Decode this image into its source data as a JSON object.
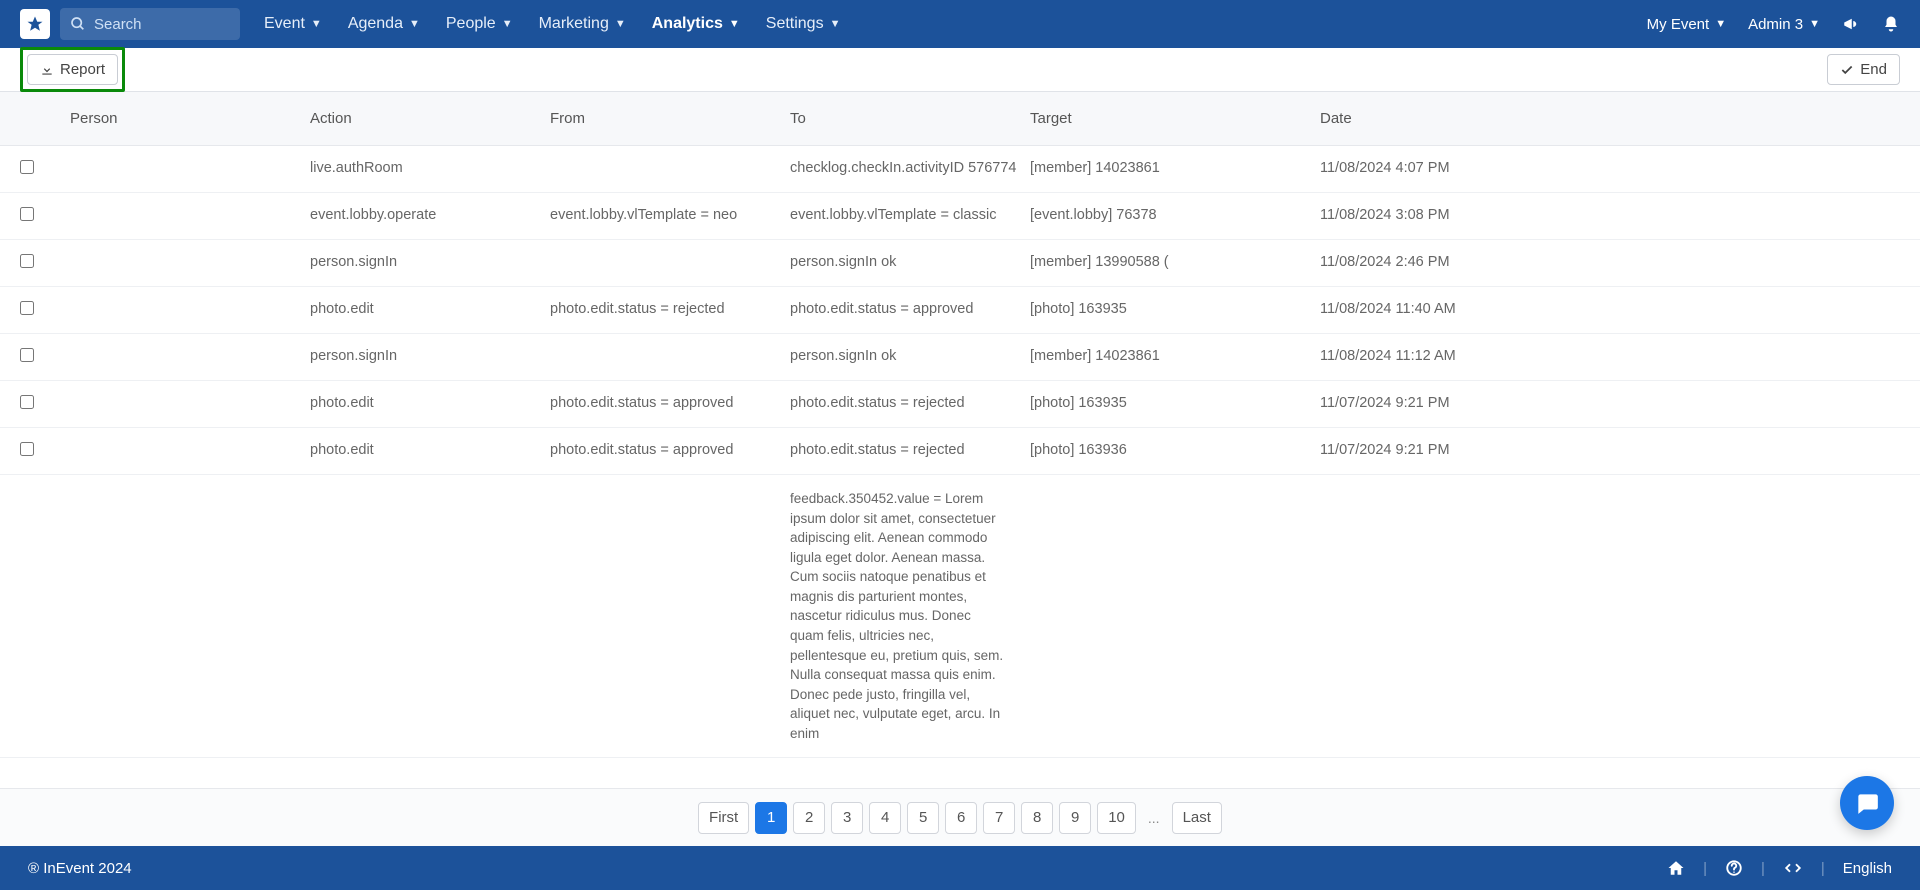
{
  "nav": {
    "search_placeholder": "Search",
    "items": [
      {
        "label": "Event",
        "active": false
      },
      {
        "label": "Agenda",
        "active": false
      },
      {
        "label": "People",
        "active": false
      },
      {
        "label": "Marketing",
        "active": false
      },
      {
        "label": "Analytics",
        "active": true
      },
      {
        "label": "Settings",
        "active": false
      }
    ],
    "context_label": "My Event",
    "user_label": "Admin 3"
  },
  "toolbar": {
    "report_label": "Report",
    "end_label": "End"
  },
  "table": {
    "headers": {
      "person": "Person",
      "action": "Action",
      "from": "From",
      "to": "To",
      "target": "Target",
      "date": "Date"
    },
    "rows": [
      {
        "person": "",
        "action": "live.authRoom",
        "from": "",
        "to": "checklog.checkIn.activityID 576774",
        "target": "[member] 14023861",
        "date": "11/08/2024 4:07 PM"
      },
      {
        "person": "",
        "action": "event.lobby.operate",
        "from": "event.lobby.vlTemplate = neo",
        "to": "event.lobby.vlTemplate = classic",
        "target": "[event.lobby] 76378",
        "date": "11/08/2024 3:08 PM"
      },
      {
        "person": "",
        "action": "person.signIn",
        "from": "",
        "to": "person.signIn ok",
        "target": "[member] 13990588 (",
        "date": "11/08/2024 2:46 PM"
      },
      {
        "person": "",
        "action": "photo.edit",
        "from": "photo.edit.status = rejected",
        "to": "photo.edit.status = approved",
        "target": "[photo] 163935",
        "date": "11/08/2024 11:40 AM"
      },
      {
        "person": "",
        "action": "person.signIn",
        "from": "",
        "to": "person.signIn ok",
        "target": "[member] 14023861",
        "date": "11/08/2024 11:12 AM"
      },
      {
        "person": "",
        "action": "photo.edit",
        "from": "photo.edit.status = approved",
        "to": "photo.edit.status = rejected",
        "target": "[photo] 163935",
        "date": "11/07/2024 9:21 PM"
      },
      {
        "person": "",
        "action": "photo.edit",
        "from": "photo.edit.status = approved",
        "to": "photo.edit.status = rejected",
        "target": "[photo] 163936",
        "date": "11/07/2024 9:21 PM"
      },
      {
        "person": "",
        "action": "",
        "from": "",
        "to": "feedback.350452.value = Lorem ipsum dolor sit amet, consectetuer adipiscing elit. Aenean commodo ligula eget dolor. Aenean massa. Cum sociis natoque penatibus et magnis dis parturient montes, nascetur ridiculus mus. Donec quam felis, ultricies nec, pellentesque eu, pretium quis, sem. Nulla consequat massa quis enim. Donec pede justo, fringilla vel, aliquet nec, vulputate eget, arcu. In enim",
        "target": "",
        "date": "",
        "long_to": true,
        "no_check": true
      }
    ]
  },
  "pagination": {
    "first_label": "First",
    "last_label": "Last",
    "pages": [
      "1",
      "2",
      "3",
      "4",
      "5",
      "6",
      "7",
      "8",
      "9",
      "10"
    ],
    "active": "1",
    "ellipsis": "..."
  },
  "footer": {
    "copyright": "® InEvent 2024",
    "language": "English"
  }
}
